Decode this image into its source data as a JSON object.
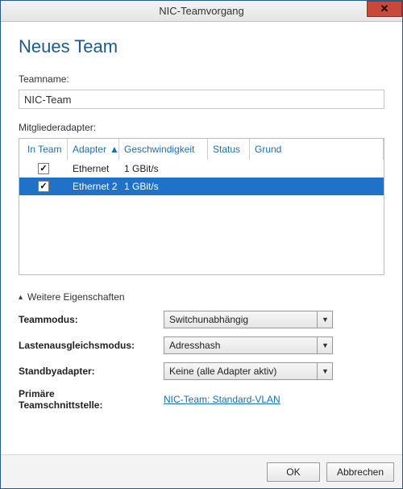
{
  "window": {
    "title": "NIC-Teamvorgang",
    "close_glyph": "✕"
  },
  "page": {
    "heading": "Neues Team"
  },
  "teamname": {
    "label": "Teamname:",
    "value": "NIC-Team"
  },
  "adapters": {
    "label": "Mitgliederadapter:",
    "columns": {
      "inteam": "In Team",
      "adapter": "Adapter",
      "speed": "Geschwindigkeit",
      "status": "Status",
      "grund": "Grund"
    },
    "sort_glyph": "▲",
    "rows": [
      {
        "checked": true,
        "adapter": "Ethernet",
        "speed": "1 GBit/s",
        "selected": false
      },
      {
        "checked": true,
        "adapter": "Ethernet 2",
        "speed": "1 GBit/s",
        "selected": true
      }
    ]
  },
  "props": {
    "expander_label": "Weitere Eigenschaften",
    "expander_glyph": "▴",
    "teammode_label": "Teammodus:",
    "teammode_value": "Switchunabhängig",
    "loadbalance_label": "Lastenausgleichsmodus:",
    "loadbalance_value": "Adresshash",
    "standby_label": "Standbyadapter:",
    "standby_value": "Keine (alle Adapter aktiv)",
    "primary_label_l1": "Primäre",
    "primary_label_l2": "Teamschnittstelle:",
    "primary_link": "NIC-Team: Standard-VLAN"
  },
  "footer": {
    "ok": "OK",
    "cancel": "Abbrechen"
  }
}
